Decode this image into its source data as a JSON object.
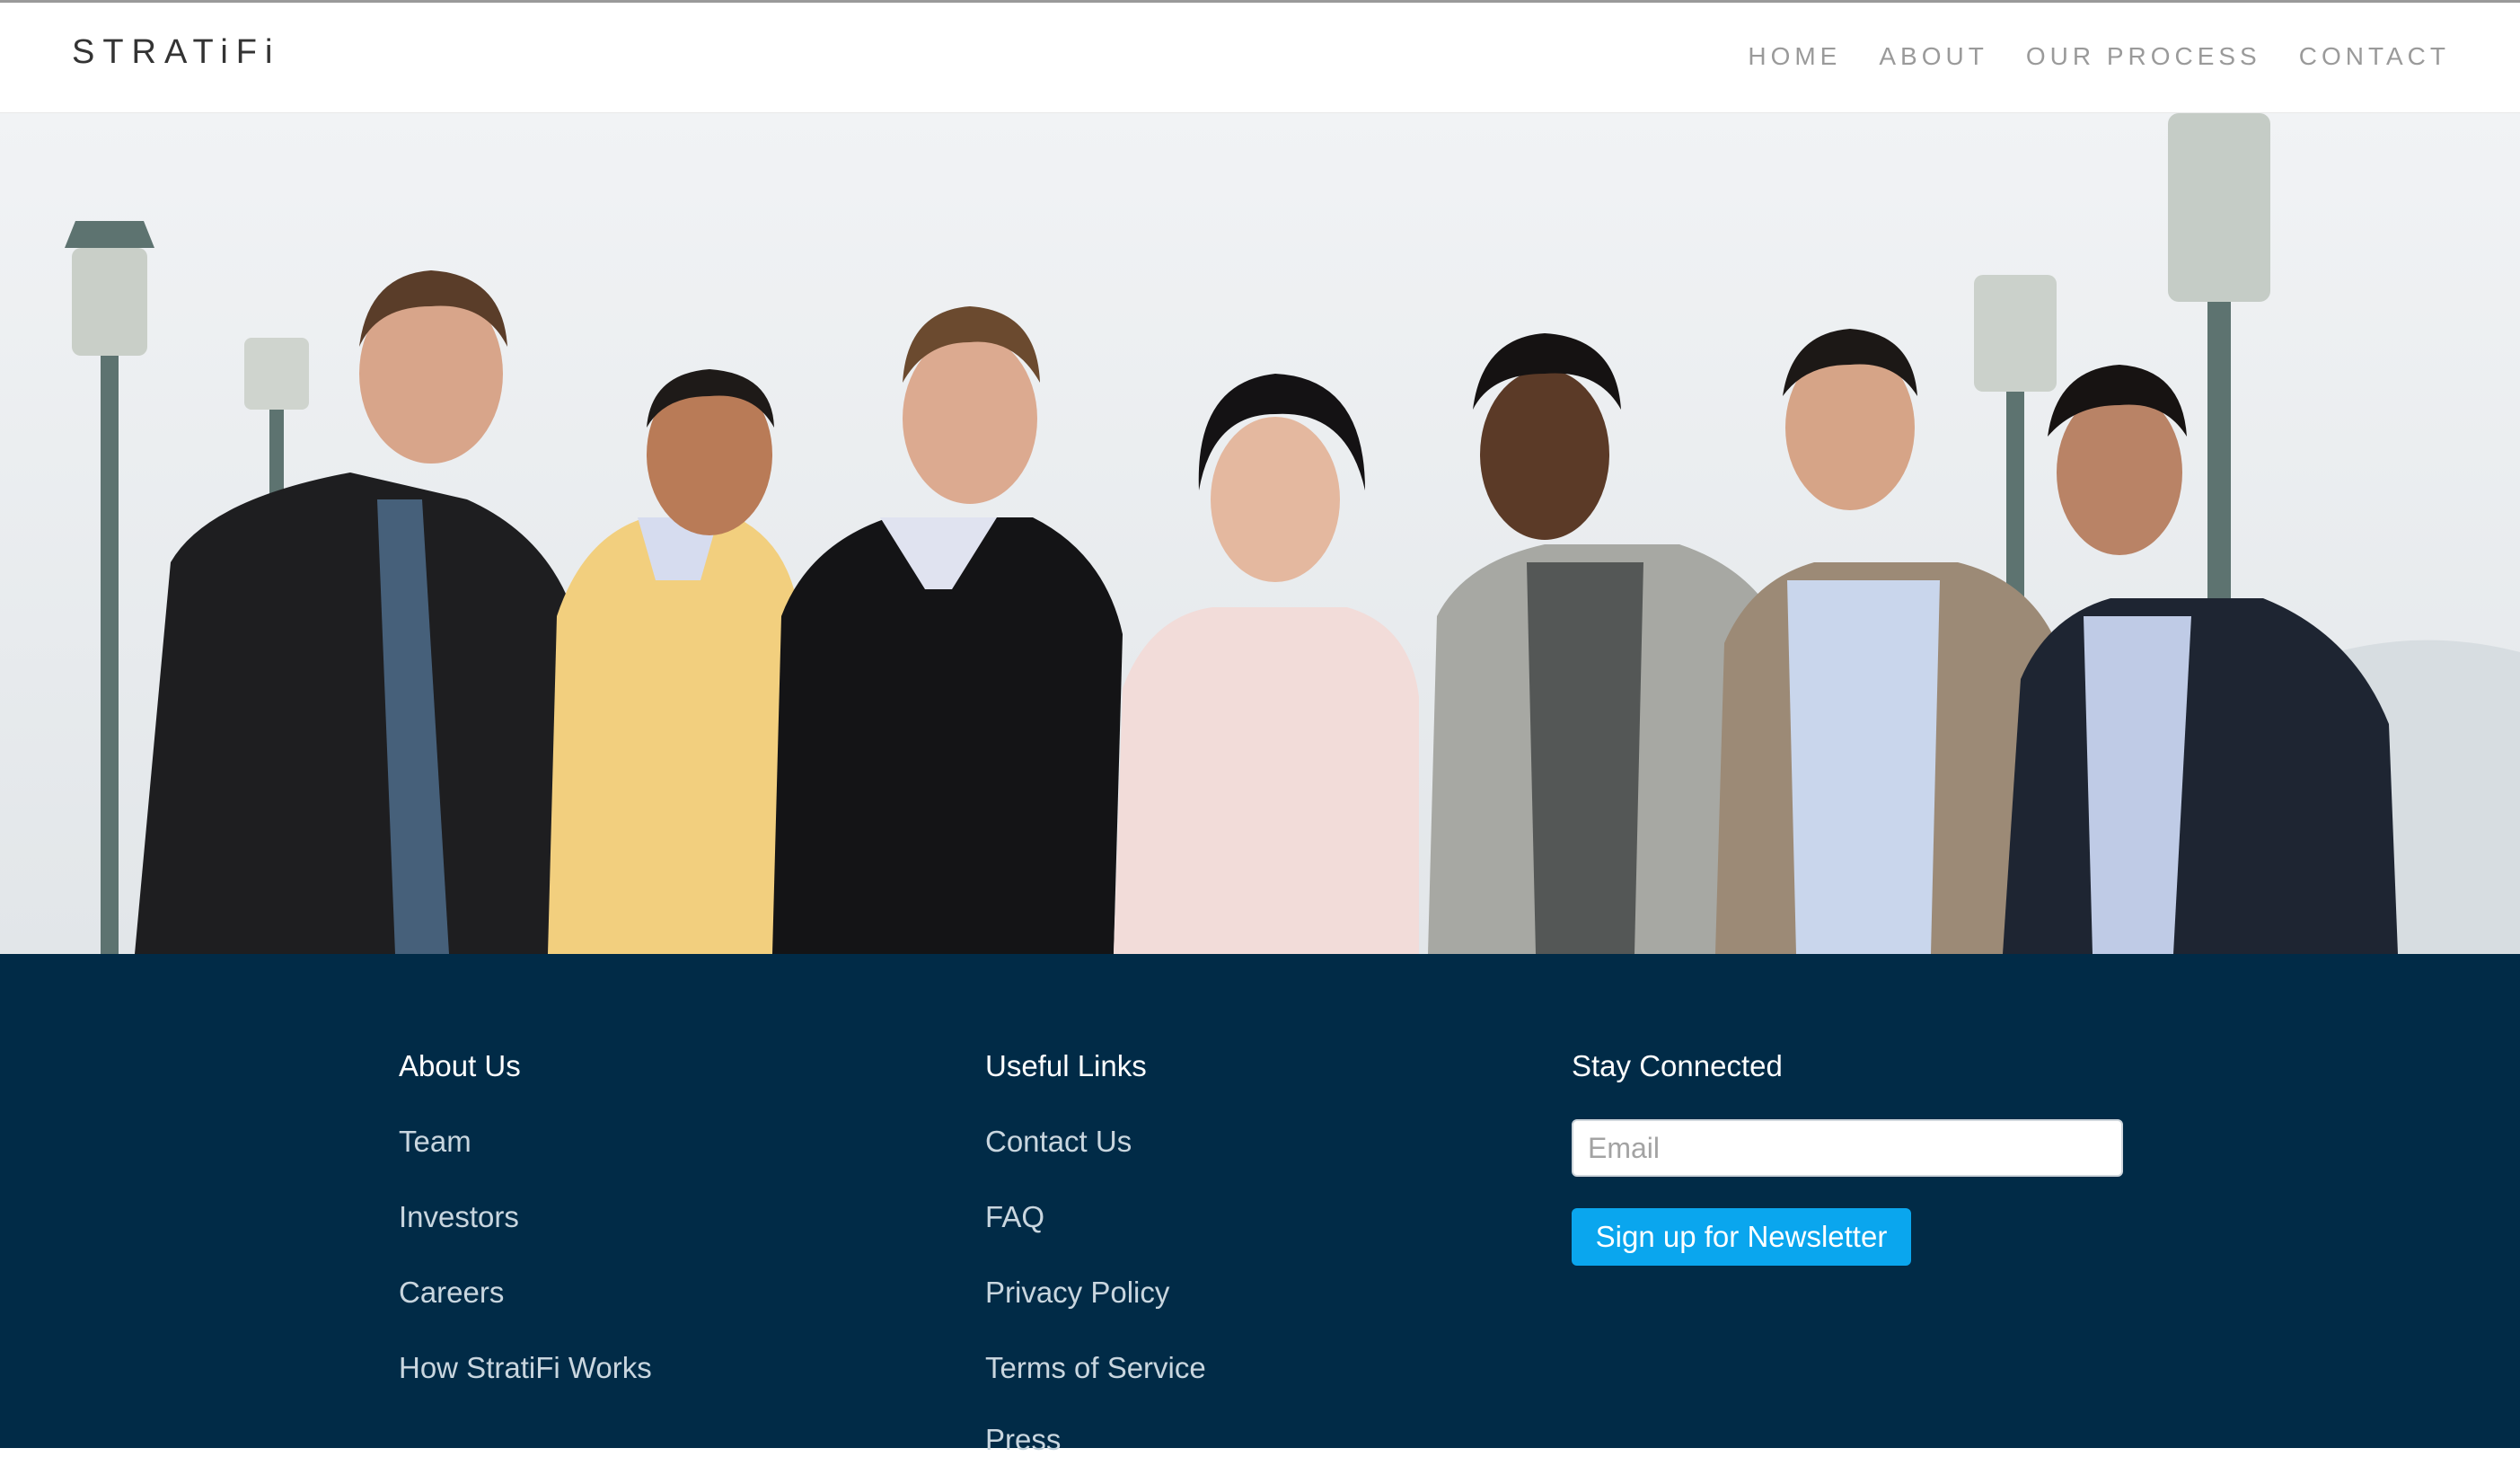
{
  "brand": {
    "logo_text": "STRATiFi"
  },
  "nav": {
    "items": [
      {
        "label": "HOME"
      },
      {
        "label": "ABOUT"
      },
      {
        "label": "OUR PROCESS"
      },
      {
        "label": "CONTACT"
      }
    ]
  },
  "hero": {
    "image": "team-photo"
  },
  "footer": {
    "about": {
      "title": "About Us",
      "links": [
        "Team",
        "Investors",
        "Careers",
        "How StratiFi Works"
      ]
    },
    "useful": {
      "title": "Useful Links",
      "links": [
        "Contact Us",
        "FAQ",
        "Privacy Policy",
        "Terms of Service",
        "Press"
      ]
    },
    "connect": {
      "title": "Stay Connected",
      "email_placeholder": "Email",
      "signup_label": "Sign up for Newsletter"
    }
  },
  "colors": {
    "footer_bg": "#012b47",
    "button_bg": "#0aa6ee",
    "nav_text": "#9a9a9a"
  }
}
